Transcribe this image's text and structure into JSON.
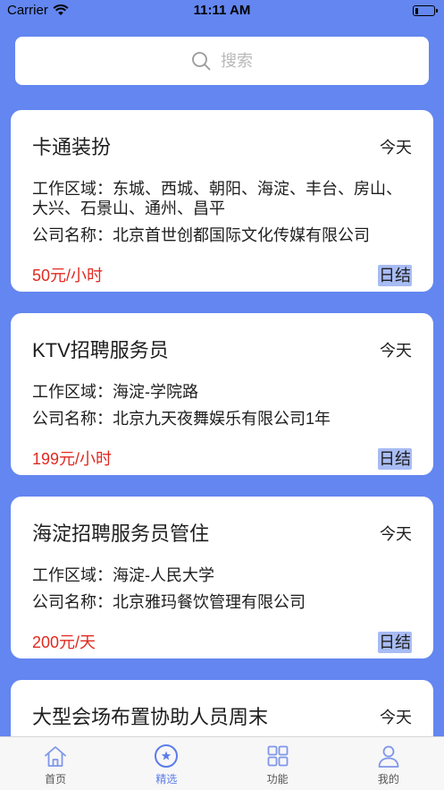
{
  "status_bar": {
    "carrier": "Carrier",
    "time": "11:11 AM",
    "wifi_icon": "wifi-icon",
    "battery_icon": "battery-icon",
    "battery_level": 0.15
  },
  "search": {
    "placeholder": "搜索",
    "icon": "search-icon"
  },
  "jobs": [
    {
      "title": "卡通装扮",
      "date": "今天",
      "area_label": "工作区域：",
      "area": "东城、西城、朝阳、海淀、丰台、房山、大兴、石景山、通州、昌平",
      "company_label": "公司名称：",
      "company": "北京首世创都国际文化传媒有限公司",
      "pay": "50元/小时",
      "settlement": "日结"
    },
    {
      "title": "KTV招聘服务员",
      "date": "今天",
      "area_label": "工作区域：",
      "area": "海淀-学院路",
      "company_label": "公司名称：",
      "company": "北京九天夜舞娱乐有限公司1年",
      "pay": "199元/小时",
      "settlement": "日结"
    },
    {
      "title": "海淀招聘服务员管住",
      "date": "今天",
      "area_label": "工作区域：",
      "area": "海淀-人民大学",
      "company_label": "公司名称：",
      "company": "北京雅玛餐饮管理有限公司",
      "pay": "200元/天",
      "settlement": "日结"
    },
    {
      "title": "大型会场布置协助人员周末",
      "date": "今天"
    }
  ],
  "tab_bar": {
    "items": [
      {
        "label": "首页",
        "icon": "home-icon",
        "selected": false
      },
      {
        "label": "精选",
        "icon": "star-circle-icon",
        "selected": true
      },
      {
        "label": "功能",
        "icon": "grid-icon",
        "selected": false
      },
      {
        "label": "我的",
        "icon": "person-icon",
        "selected": false
      }
    ]
  },
  "colors": {
    "background": "#6386F0",
    "accent": "#5B7CE8",
    "pay": "#E02A20",
    "badge": "#A8BCF4"
  }
}
